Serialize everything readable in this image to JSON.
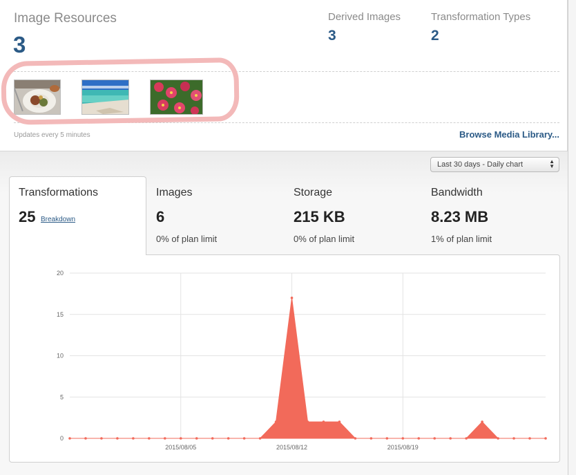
{
  "resources": {
    "title": "Image Resources",
    "count": "3",
    "thumbnails": [
      {
        "icon": "food-plate-photo"
      },
      {
        "icon": "beach-photo"
      },
      {
        "icon": "flowers-photo"
      }
    ]
  },
  "stats": {
    "derived_label": "Derived Images",
    "derived_value": "3",
    "types_label": "Transformation Types",
    "types_value": "2"
  },
  "footer": {
    "updates_text": "Updates every 5 minutes",
    "browse_link": "Browse Media Library..."
  },
  "range_select": {
    "selected": "Last 30 days - Daily chart"
  },
  "tabs": [
    {
      "label": "Transformations",
      "value": "25",
      "link": "Breakdown"
    },
    {
      "label": "Images",
      "value": "6",
      "sub": "0% of plan limit"
    },
    {
      "label": "Storage",
      "value": "215 KB",
      "sub": "0% of plan limit"
    },
    {
      "label": "Bandwidth",
      "value": "8.23 MB",
      "sub": "1% of plan limit"
    }
  ],
  "colors": {
    "accent": "#2b5a86",
    "series": "#f26a5a"
  },
  "chart_data": {
    "type": "area",
    "x": [
      "2015/07/29",
      "2015/07/30",
      "2015/07/31",
      "2015/08/01",
      "2015/08/02",
      "2015/08/03",
      "2015/08/04",
      "2015/08/05",
      "2015/08/06",
      "2015/08/07",
      "2015/08/08",
      "2015/08/09",
      "2015/08/10",
      "2015/08/11",
      "2015/08/12",
      "2015/08/13",
      "2015/08/14",
      "2015/08/15",
      "2015/08/16",
      "2015/08/17",
      "2015/08/18",
      "2015/08/19",
      "2015/08/20",
      "2015/08/21",
      "2015/08/22",
      "2015/08/23",
      "2015/08/24",
      "2015/08/25",
      "2015/08/26",
      "2015/08/27",
      "2015/08/28"
    ],
    "values": [
      0,
      0,
      0,
      0,
      0,
      0,
      0,
      0,
      0,
      0,
      0,
      0,
      0,
      2,
      17,
      2,
      2,
      2,
      0,
      0,
      0,
      0,
      0,
      0,
      0,
      0,
      2,
      0,
      0,
      0,
      0
    ],
    "x_ticks": [
      "2015/08/05",
      "2015/08/12",
      "2015/08/19"
    ],
    "y_ticks": [
      "0",
      "5",
      "10",
      "15",
      "20"
    ],
    "ylim": [
      0,
      20
    ],
    "grid": true
  }
}
